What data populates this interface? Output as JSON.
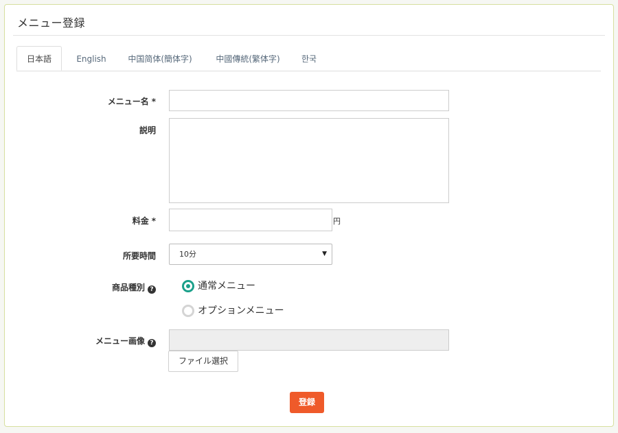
{
  "panel": {
    "title": "メニュー登録"
  },
  "tabs": [
    {
      "label": "日本語",
      "active": true
    },
    {
      "label": "English",
      "active": false
    },
    {
      "label": "中国简体(簡体字)",
      "active": false
    },
    {
      "label": "中國傳統(繁体字)",
      "active": false
    },
    {
      "label": "한국",
      "active": false
    }
  ],
  "form": {
    "menu_name": {
      "label": "メニュー名",
      "required_mark": "*",
      "value": ""
    },
    "description": {
      "label": "説明",
      "value": ""
    },
    "price": {
      "label": "料金",
      "required_mark": "*",
      "value": "",
      "unit": "円"
    },
    "duration": {
      "label": "所要時間",
      "selected": "10分"
    },
    "product_type": {
      "label": "商品種別",
      "help_icon": "question-circle-icon",
      "options": [
        {
          "label": "通常メニュー",
          "selected": true
        },
        {
          "label": "オプションメニュー",
          "selected": false
        }
      ]
    },
    "menu_image": {
      "label": "メニュー画像",
      "help_icon": "question-circle-icon",
      "file_button_label": "ファイル選択"
    }
  },
  "submit": {
    "label": "登録"
  },
  "colors": {
    "accent_green": "#1aa08a",
    "submit_orange": "#ef5a2a",
    "panel_border": "#d6df9e"
  }
}
